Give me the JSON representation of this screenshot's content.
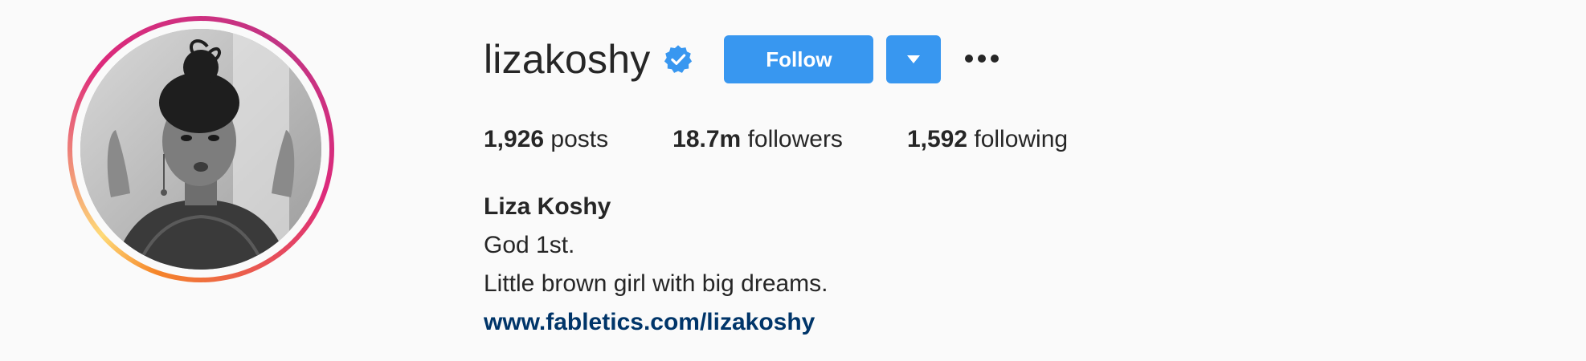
{
  "profile": {
    "username": "lizakoshy",
    "verified": true,
    "follow_label": "Follow",
    "stats": {
      "posts_count": "1,926",
      "posts_label": "posts",
      "followers_count": "18.7m",
      "followers_label": "followers",
      "following_count": "1,592",
      "following_label": "following"
    },
    "full_name": "Liza Koshy",
    "bio_lines": [
      "God 1st.",
      "Little brown girl with big dreams."
    ],
    "website": "www.fabletics.com/lizakoshy"
  },
  "icons": {
    "verified": "verified-badge-icon",
    "dropdown": "caret-down-icon",
    "more": "more-horizontal-icon"
  },
  "colors": {
    "accent_button": "#3897f0",
    "verified_blue": "#3897f0",
    "link": "#003569",
    "text": "#262626",
    "background": "#fafafa"
  }
}
